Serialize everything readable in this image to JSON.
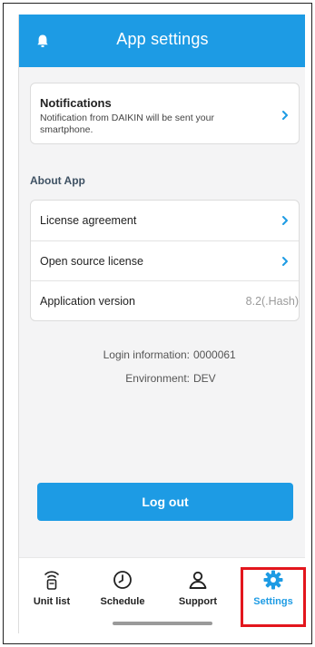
{
  "header": {
    "title": "App settings",
    "icon": "bell-icon"
  },
  "notifications": {
    "title": "Notifications",
    "description": "Notification from DAIKIN will be sent your smartphone."
  },
  "about": {
    "section_label": "About App",
    "items": [
      {
        "label": "License agreement"
      },
      {
        "label": "Open source license"
      },
      {
        "label": "Application version",
        "value": "8.2(.Hash)"
      }
    ]
  },
  "info": {
    "login_label": "Login information:",
    "login_value": "0000061",
    "env_label": "Environment:",
    "env_value": "DEV"
  },
  "logout_label": "Log out",
  "tabs": [
    {
      "label": "Unit list",
      "icon": "remote-icon"
    },
    {
      "label": "Schedule",
      "icon": "clock-icon"
    },
    {
      "label": "Support",
      "icon": "user-icon"
    },
    {
      "label": "Settings",
      "icon": "gear-icon",
      "active": true
    }
  ],
  "colors": {
    "accent": "#1d9be4",
    "highlight": "#e3161d",
    "section": "#3e5163"
  }
}
